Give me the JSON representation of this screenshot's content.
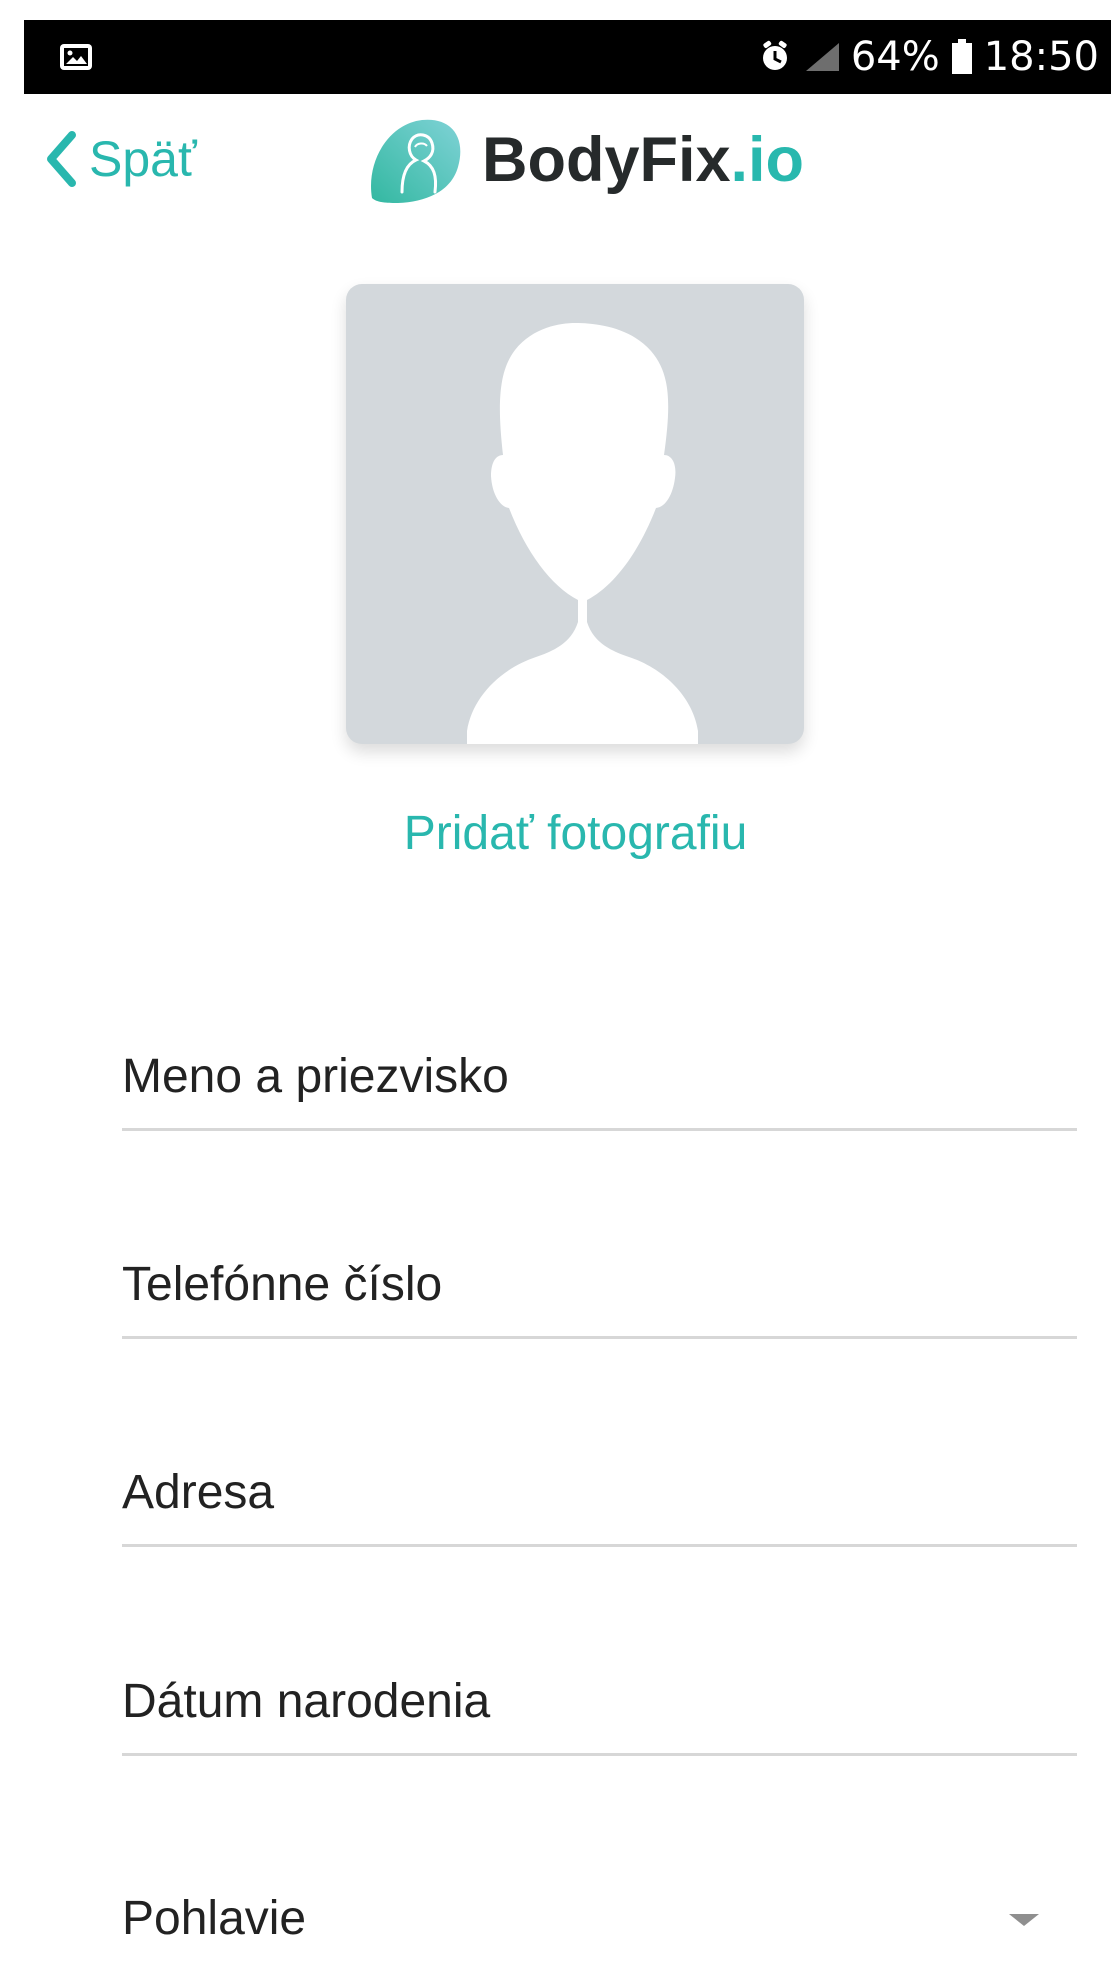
{
  "status_bar": {
    "battery": "64%",
    "time": "18:50",
    "icons": [
      "image-icon",
      "alarm-icon",
      "signal-icon",
      "battery-icon"
    ]
  },
  "header": {
    "back_label": "Späť",
    "logo_text": "BodyFix",
    "logo_accent": ".io"
  },
  "profile": {
    "add_photo_label": "Pridať fotografiu"
  },
  "form": {
    "fields": [
      {
        "label": "Meno a priezvisko"
      },
      {
        "label": "Telefónne číslo"
      },
      {
        "label": "Adresa"
      },
      {
        "label": "Dátum narodenia"
      },
      {
        "label": "Pohlavie"
      }
    ]
  },
  "colors": {
    "accent": "#29b7ae",
    "status_bar": "#000000",
    "avatar_background": "#d3d8dc",
    "divider": "#d7d7d7"
  }
}
